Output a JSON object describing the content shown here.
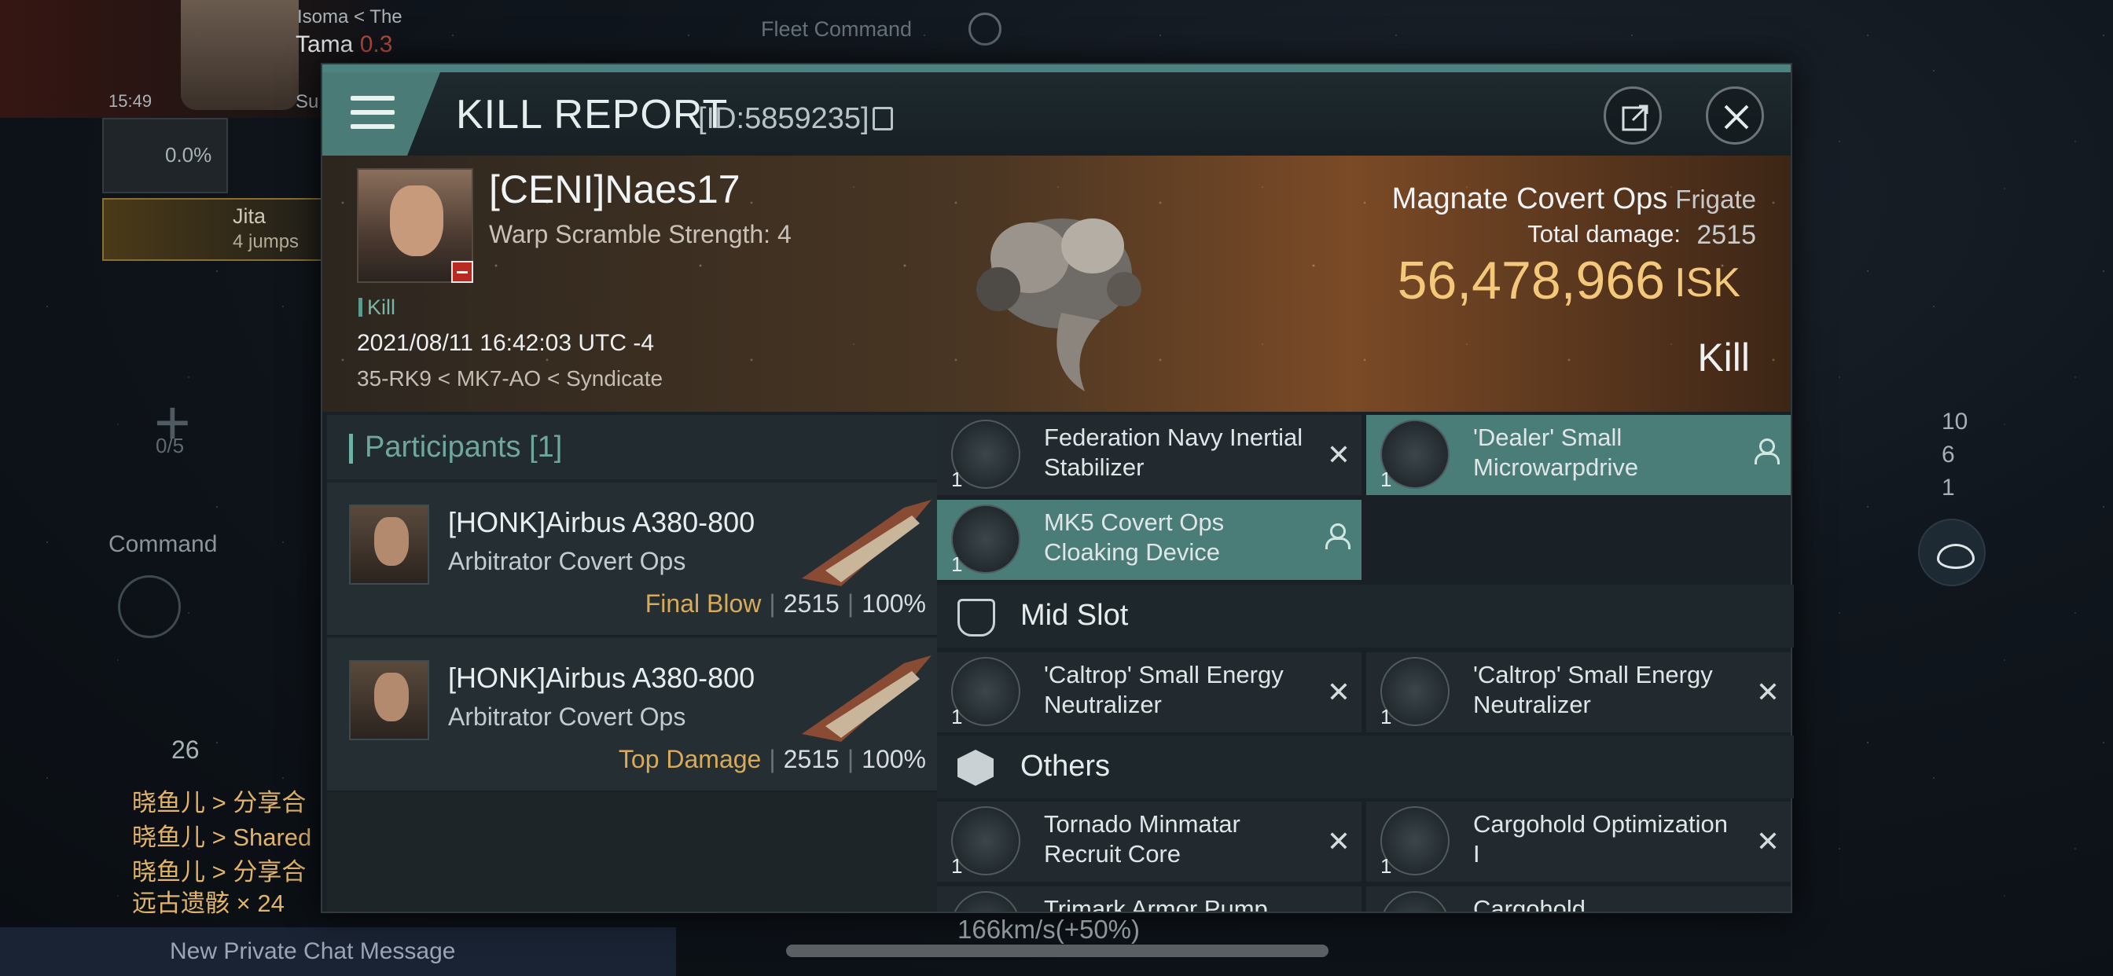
{
  "background": {
    "location_parts": [
      "Isoma",
      "The",
      "Tama",
      "0.3"
    ],
    "time": "15:49",
    "security_short": "Su",
    "cargo_percent": "0.0%",
    "destination": "Jita",
    "jumps": "4 jumps",
    "fleet_command": "Fleet Command",
    "fleet_slots": "0/5",
    "command_label": "Command",
    "local_count": "26",
    "chat_lines": [
      "晓鱼儿 > 分享合",
      "晓鱼儿 > Shared",
      "晓鱼儿 > 分享合",
      "远古遗骸 × 24"
    ],
    "new_chat": "New Private Chat Message",
    "speed": "166km/s(+50%)",
    "right_counts": [
      "10",
      "6",
      "1"
    ]
  },
  "dialog": {
    "title": "KILL REPORT",
    "id_text": "[ID:5859235]",
    "victim": {
      "name": "[CENI]Naes17",
      "scramble": "Warp Scramble Strength: 4",
      "tag": "Kill",
      "datetime": "2021/08/11 16:42:03 UTC -4",
      "location": "35-RK9 < MK7-AO < Syndicate"
    },
    "ship": {
      "name": "Magnate Covert Ops",
      "class": "Frigate",
      "damage_label": "Total damage:",
      "damage_value": "2515",
      "isk_value": "56,478,966",
      "isk_unit": "ISK",
      "result": "Kill"
    },
    "participants": {
      "label": "Participants [1]",
      "rows": [
        {
          "name": "[HONK]Airbus A380-800",
          "ship": "Arbitrator Covert Ops",
          "tag": "Final Blow",
          "damage": "2515",
          "percent": "100%"
        },
        {
          "name": "[HONK]Airbus A380-800",
          "ship": "Arbitrator Covert Ops",
          "tag": "Top Damage",
          "damage": "2515",
          "percent": "100%"
        }
      ]
    },
    "modules": {
      "low": [
        {
          "qty": "1",
          "name": "Federation Navy Inertial Stabilizer",
          "state": "destroyed"
        },
        {
          "qty": "1",
          "name": "'Dealer' Small Microwarpdrive",
          "state": "dropped"
        },
        {
          "qty": "1",
          "name": "MK5 Covert Ops Cloaking Device",
          "state": "dropped"
        }
      ],
      "mid_label": "Mid Slot",
      "mid": [
        {
          "qty": "1",
          "name": "'Caltrop' Small Energy Neutralizer",
          "state": "destroyed"
        },
        {
          "qty": "1",
          "name": "'Caltrop' Small Energy Neutralizer",
          "state": "destroyed"
        }
      ],
      "others_label": "Others",
      "others": [
        {
          "qty": "1",
          "name": "Tornado Minmatar Recruit Core",
          "state": "destroyed"
        },
        {
          "qty": "1",
          "name": "Cargohold Optimization I",
          "state": "destroyed"
        },
        {
          "qty": "",
          "name": "Trimark Armor Pump",
          "state": "destroyed"
        },
        {
          "qty": "",
          "name": "Cargohold",
          "state": "destroyed"
        }
      ]
    }
  },
  "colors": {
    "accent": "#4b7d78",
    "isk": "#f3c87a",
    "final_blow": "#d8ab5a"
  }
}
